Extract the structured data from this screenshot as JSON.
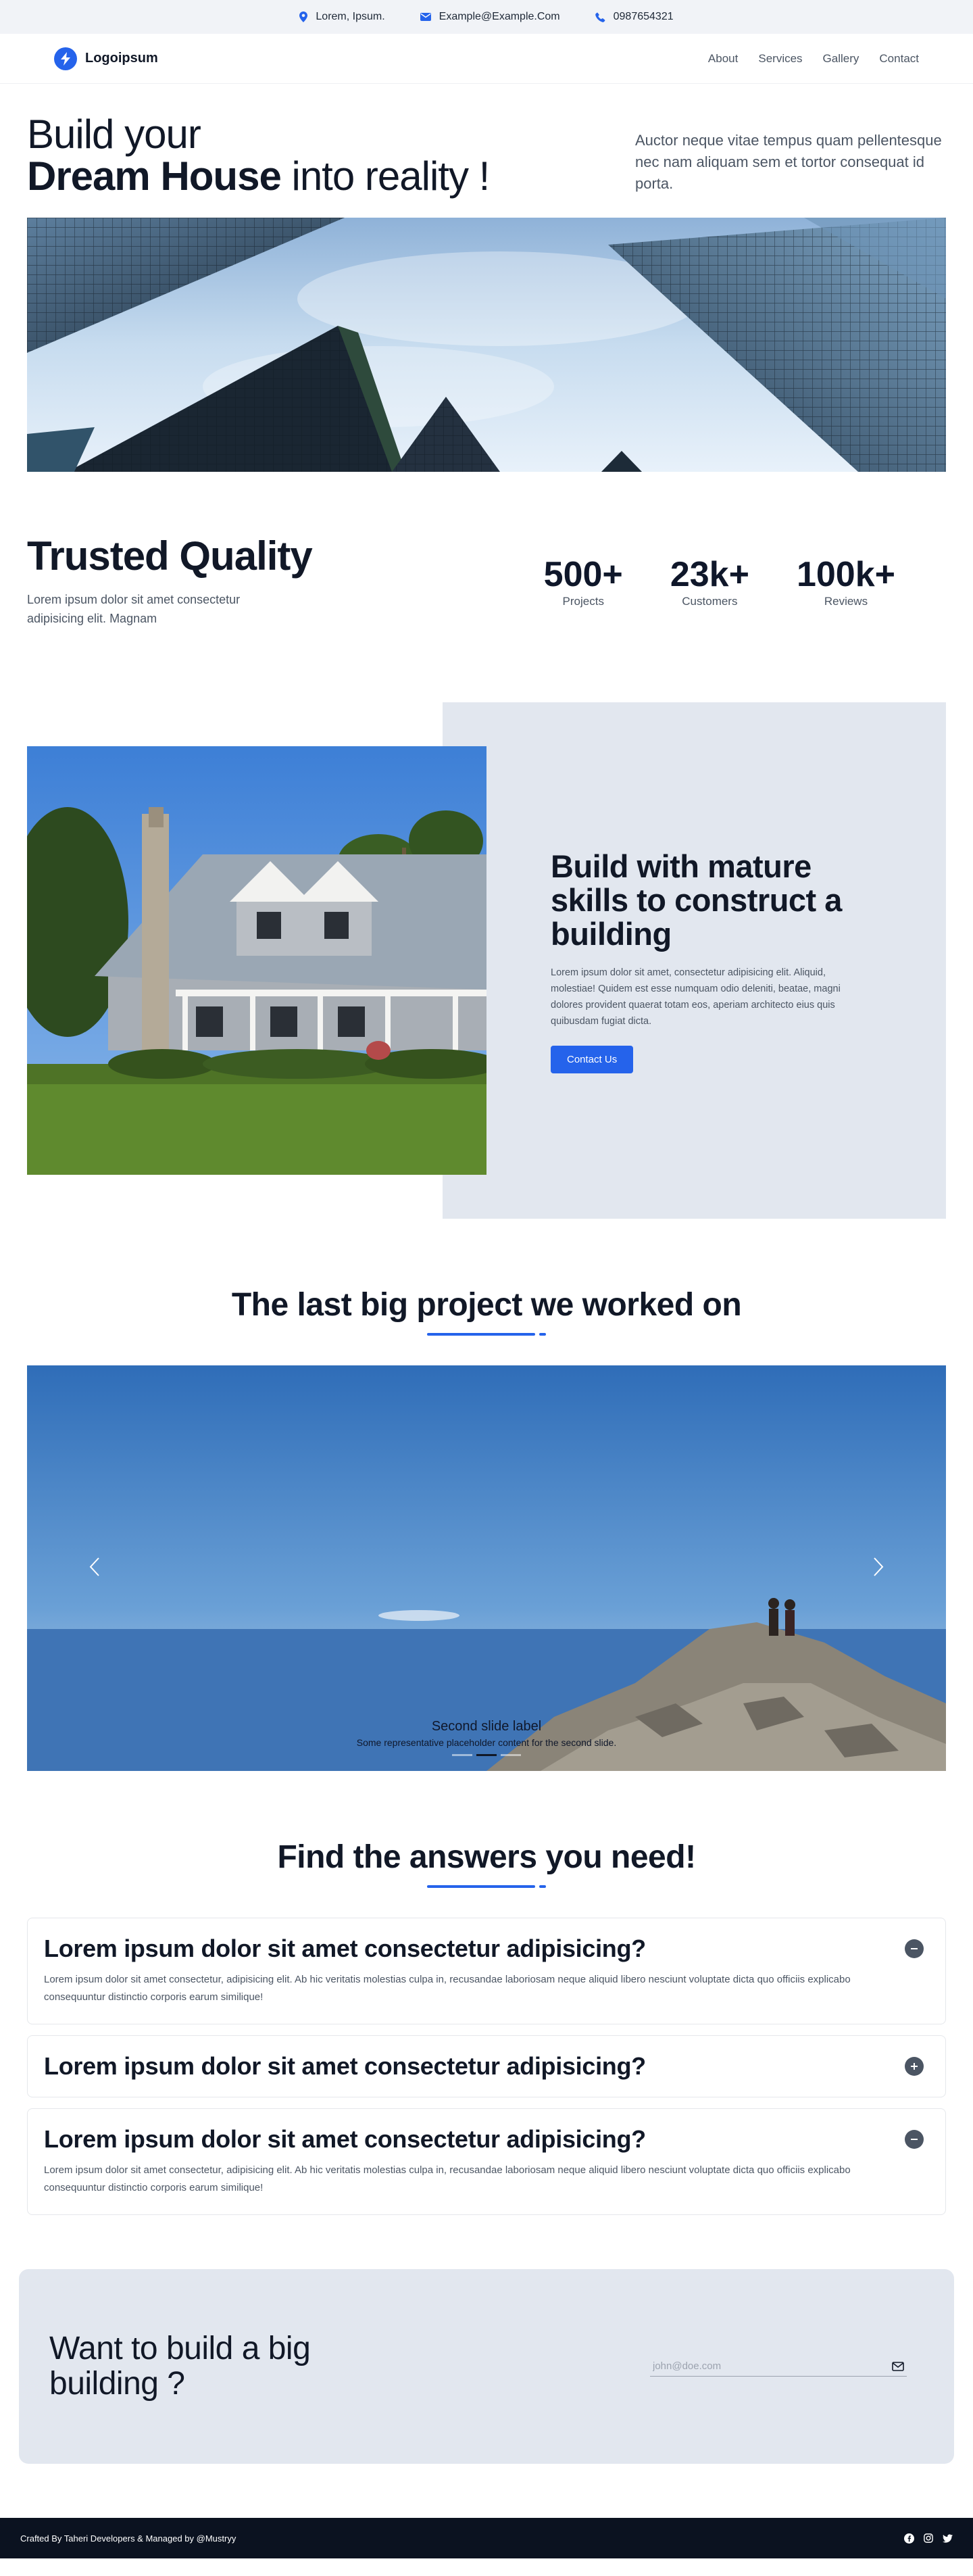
{
  "topbar": {
    "location": "Lorem, Ipsum.",
    "email": "Example@Example.Com",
    "phone": "0987654321"
  },
  "brand": {
    "name": "Logoipsum",
    "accent": "#2563eb"
  },
  "nav": {
    "items": [
      "About",
      "Services",
      "Gallery",
      "Contact"
    ]
  },
  "hero": {
    "title_line1": "Build your",
    "title_bold": "Dream House",
    "title_rest": " into reality !",
    "subtitle": "Auctor neque vitae tempus quam pellentesque nec nam aliquam sem et tortor consequat id porta."
  },
  "trusted": {
    "title": "Trusted Quality",
    "text": "Lorem ipsum dolor sit amet consectetur adipisicing elit. Magnam",
    "stats": [
      {
        "num": "500+",
        "label": "Projects"
      },
      {
        "num": "23k+",
        "label": "Customers"
      },
      {
        "num": "100k+",
        "label": "Reviews"
      }
    ]
  },
  "build": {
    "title": "Build with mature skills to construct a building",
    "text": "Lorem ipsum dolor sit amet, consectetur adipisicing elit. Aliquid, molestiae! Quidem est esse numquam odio deleniti, beatae, magni dolores provident quaerat totam eos, aperiam architecto eius quis quibusdam fugiat dicta.",
    "button": "Contact Us"
  },
  "project": {
    "title": "The last big project we worked on",
    "slide_title": "Second slide label",
    "slide_text": "Some representative placeholder content for the second slide."
  },
  "faq": {
    "title": "Find the answers you need!",
    "items": [
      {
        "q": "Lorem ipsum dolor sit amet consectetur adipisicing?",
        "a": "Lorem ipsum dolor sit amet consectetur, adipisicing elit. Ab hic veritatis molestias culpa in, recusandae laboriosam neque aliquid libero nesciunt voluptate dicta quo officiis explicabo consequuntur distinctio corporis earum similique!",
        "open": true
      },
      {
        "q": "Lorem ipsum dolor sit amet consectetur adipisicing?",
        "a": "",
        "open": false
      },
      {
        "q": "Lorem ipsum dolor sit amet consectetur adipisicing?",
        "a": "Lorem ipsum dolor sit amet consectetur, adipisicing elit. Ab hic veritatis molestias culpa in, recusandae laboriosam neque aliquid libero nesciunt voluptate dicta quo officiis explicabo consequuntur distinctio corporis earum similique!",
        "open": true
      }
    ]
  },
  "cta": {
    "title": "Want to build a big building ?",
    "placeholder": "john@doe.com"
  },
  "footer": {
    "credit": "Crafted By Taheri Developers & Managed by @Mustryy",
    "socials": [
      "facebook-icon",
      "instagram-icon",
      "twitter-icon"
    ]
  }
}
